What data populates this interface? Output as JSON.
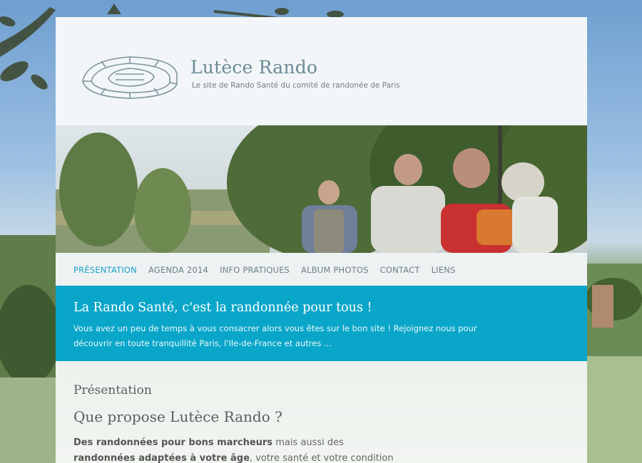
{
  "site": {
    "title": "Lutèce Rando",
    "subtitle": "Le site de Rando Santé du comité de randonée de Paris"
  },
  "nav": {
    "items": [
      {
        "label": "Présentation",
        "active": true
      },
      {
        "label": "Agenda 2014",
        "active": false
      },
      {
        "label": "Info pratiques",
        "active": false
      },
      {
        "label": "Album photos",
        "active": false
      },
      {
        "label": "Contact",
        "active": false
      },
      {
        "label": "Liens",
        "active": false
      }
    ]
  },
  "banner": {
    "title": "La Rando Santé, c'est la randonnée pour tous !",
    "text": "Vous avez un peu de temps à vous consacrer alors vous êtes sur le bon site ! Rejoignez nous pour découvrir en toute tranquillité Paris, l'Ile-de-France et autres ..."
  },
  "content": {
    "section_title": "Présentation",
    "article_title": "Que propose Lutèce Rando ?",
    "line1_bold": "Des randonnées pour bons marcheurs",
    "line1_rest": " mais aussi des",
    "line2_bold": "randonnées adaptées à votre âge",
    "line2_rest": ", votre santé et votre condition"
  },
  "colors": {
    "accent": "#0aa6c9",
    "nav_active": "#1aa3c6"
  }
}
